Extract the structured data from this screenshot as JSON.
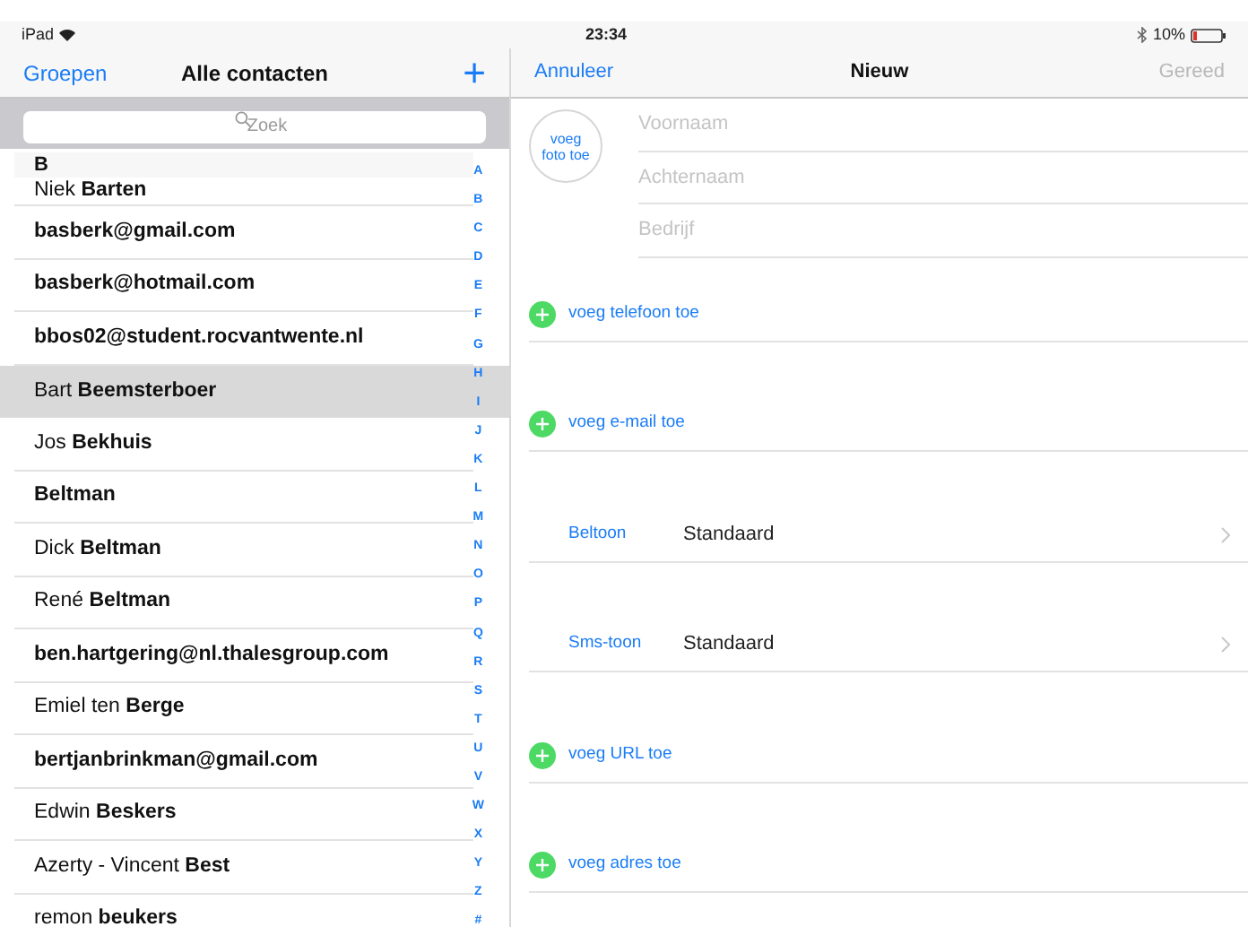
{
  "status_bar": {
    "device": "iPad",
    "time": "23:34",
    "battery": "10%"
  },
  "contacts_nav": {
    "left": "Groepen",
    "title": "Alle contacten",
    "add": "+"
  },
  "search": {
    "placeholder": "Zoek"
  },
  "section_header": "B",
  "contacts": [
    {
      "name": "Niek **Barten**",
      "bold": false,
      "selected": false
    },
    {
      "name": "basberk@gmail.com",
      "bold": true,
      "selected": false
    },
    {
      "name": "basberk@hotmail.com",
      "bold": true,
      "selected": false
    },
    {
      "name": "bbos02@student.rocvantwente.nl",
      "bold": true,
      "selected": false
    },
    {
      "name": "Bart **Beemsterboer**",
      "bold": false,
      "selected": true
    },
    {
      "name": "Jos **Bekhuis**",
      "bold": false,
      "selected": false
    },
    {
      "name": "Beltman",
      "bold": true,
      "selected": false
    },
    {
      "name": "Dick **Beltman**",
      "bold": false,
      "selected": false
    },
    {
      "name": "René **Beltman**",
      "bold": false,
      "selected": false
    },
    {
      "name": "ben.hartgering@nl.thalesgroup.com",
      "bold": true,
      "selected": false
    },
    {
      "name": "Emiel ten **Berge**",
      "bold": false,
      "selected": false
    },
    {
      "name": "bertjanbrinkman@gmail.com",
      "bold": true,
      "selected": false
    },
    {
      "name": "Edwin **Beskers**",
      "bold": false,
      "selected": false
    },
    {
      "name": "Azerty - Vincent **Best**",
      "bold": false,
      "selected": false
    },
    {
      "name": "remon **beukers**",
      "bold": false,
      "selected": false
    }
  ],
  "index": [
    "A",
    "B",
    "C",
    "D",
    "E",
    "F",
    "G",
    "H",
    "I",
    "J",
    "K",
    "L",
    "M",
    "N",
    "O",
    "P",
    "Q",
    "R",
    "S",
    "T",
    "U",
    "V",
    "W",
    "X",
    "Y",
    "Z",
    "#"
  ],
  "new_nav": {
    "cancel": "Annuleer",
    "title": "Nieuw",
    "done": "Gereed",
    "done_disabled": true
  },
  "photo_button": "voeg foto toe",
  "name_fields": [
    {
      "placeholder": "Voornaam"
    },
    {
      "placeholder": "Achternaam"
    },
    {
      "placeholder": "Bedrijf"
    }
  ],
  "sections": [
    {
      "kind": "add",
      "label": "voeg telefoon toe"
    },
    {
      "kind": "add",
      "label": "voeg e-mail toe"
    },
    {
      "kind": "setting",
      "label": "Beltoon",
      "value": "Standaard"
    },
    {
      "kind": "setting",
      "label": "Sms-toon",
      "value": "Standaard"
    },
    {
      "kind": "add",
      "label": "voeg URL toe"
    },
    {
      "kind": "add",
      "label": "voeg adres toe"
    }
  ]
}
